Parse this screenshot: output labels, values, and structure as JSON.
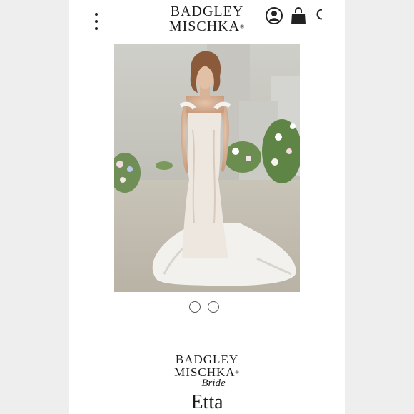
{
  "header": {
    "logo_line1": "BADGLEY",
    "logo_line2": "MISCHKA",
    "logo_reg": "®"
  },
  "product": {
    "brand_line1": "BADGLEY",
    "brand_line2": "MISCHKA",
    "brand_reg": "®",
    "brand_script": "Bride",
    "name": "Etta"
  },
  "carousel": {
    "slides": 2,
    "active": 1
  },
  "icons": {
    "menu": "kebab-menu-icon",
    "account": "user-icon",
    "bag": "shopping-bag-icon"
  }
}
